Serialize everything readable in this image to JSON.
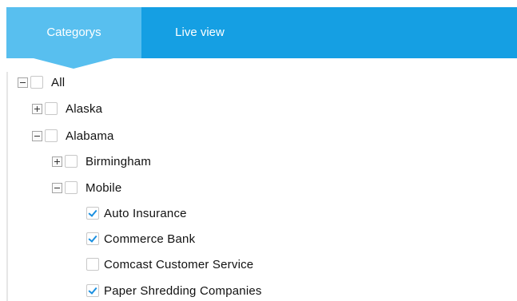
{
  "tabs": {
    "categories_label": "Categorys",
    "live_view_label": "Live view"
  },
  "tree": {
    "all": {
      "label": "All",
      "expanded": true,
      "checked": false
    },
    "alaska": {
      "label": "Alaska",
      "expanded": false,
      "checked": false
    },
    "alabama": {
      "label": "Alabama",
      "expanded": true,
      "checked": false
    },
    "birmingham": {
      "label": "Birmingham",
      "expanded": false,
      "checked": false
    },
    "mobile": {
      "label": "Mobile",
      "expanded": true,
      "checked": false
    },
    "auto_insurance": {
      "label": "Auto Insurance",
      "checked": true
    },
    "commerce_bank": {
      "label": "Commerce Bank",
      "checked": true
    },
    "comcast": {
      "label": "Comcast Customer Service",
      "checked": false
    },
    "paper_shredding": {
      "label": "Paper Shredding Companies",
      "checked": true
    }
  },
  "colors": {
    "tab_bar": "#159fe3",
    "active_tab": "#58bfef",
    "check_mark": "#1a8fe0"
  }
}
